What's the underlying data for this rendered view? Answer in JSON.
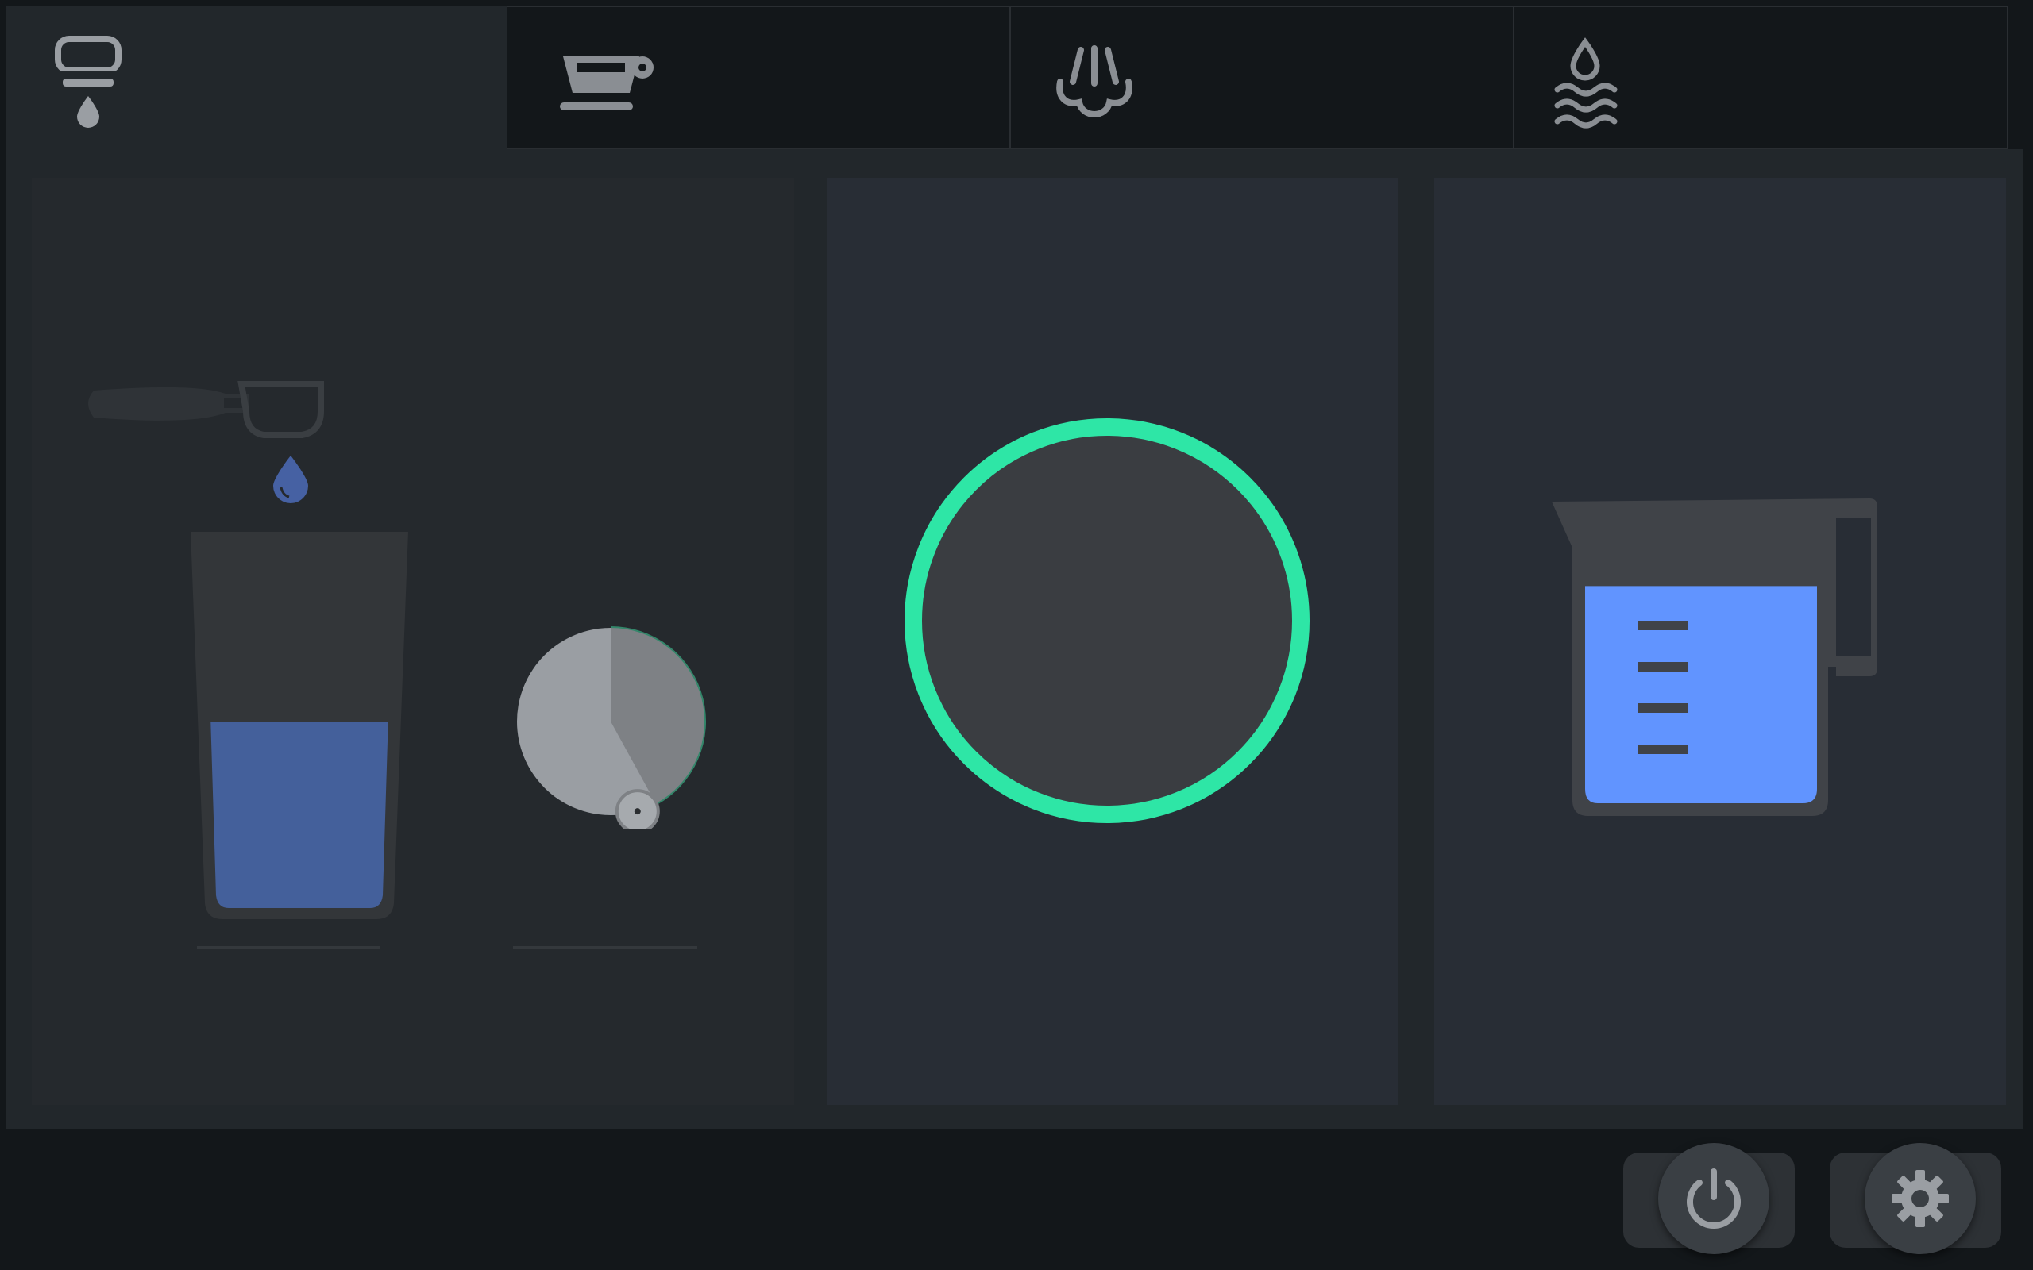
{
  "tabs": [
    {
      "name": "group-head-icon",
      "active": true
    },
    {
      "name": "cup-icon",
      "active": false
    },
    {
      "name": "steam-icon",
      "active": false
    },
    {
      "name": "hot-water-icon",
      "active": false
    }
  ],
  "brew_panel": {
    "glass_fill_fraction": 0.5,
    "shot_timer_progress": 0.42
  },
  "start_button": {
    "ring_color": "#2ee6a6"
  },
  "hot_water_panel": {
    "pitcher_fill_fraction": 0.9,
    "water_color": "#6194ff"
  },
  "controls": {
    "power": "power-icon",
    "settings": "gear-icon"
  }
}
